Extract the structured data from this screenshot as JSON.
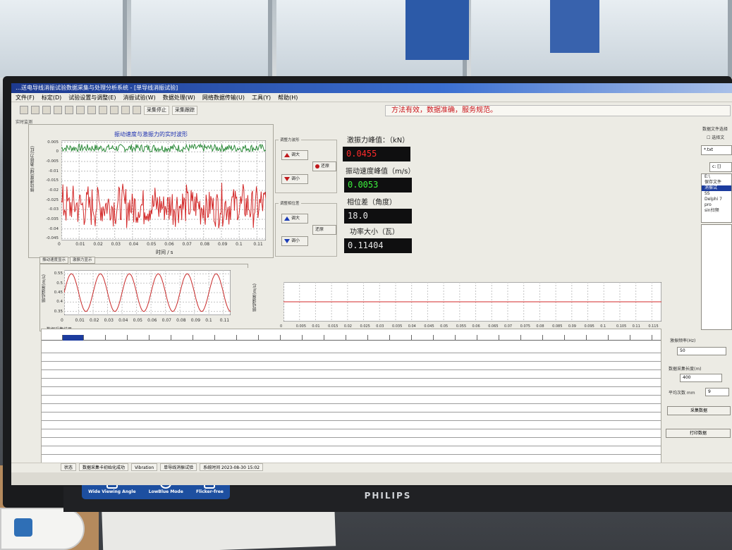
{
  "window": {
    "title": "…送电导线消振试验数据采集与处理分析系统 - [单导线消振试验]"
  },
  "menu": [
    "文件(F)",
    "标定(D)",
    "试验设置与调整(E)",
    "消振试验(W)",
    "数据处理(W)",
    "网络数据传输(U)",
    "工具(Y)",
    "帮助(H)"
  ],
  "toolbar": {
    "collect_label": "采集停止",
    "collect_trace_label": "采集跟踪",
    "slogan": "方法有效，数据准确，服务规范。"
  },
  "section_label": "实时监测",
  "top_chart": {
    "title": "振动速度与激振力的实时波形",
    "ylabel": "振动速度(绿)  激振力(红)",
    "xlabel": "时间 / s"
  },
  "controls": {
    "force_group": "调整力波形",
    "force_up": "调大",
    "force_down": "调小",
    "force_reset": "还原",
    "phase_group": "调整相位差",
    "phase_up": "调大",
    "phase_down": "调小",
    "phase_reset": "还原"
  },
  "readouts": {
    "force_label": "激振力峰值：（kN）",
    "force_value": "0.0455",
    "velocity_label": "振动速度峰值（m/s）",
    "velocity_value": "0.0053",
    "phase_label": "相位差（角度）",
    "phase_value": "18.0",
    "power_label": "功率大小（瓦）",
    "power_value": "0.11404"
  },
  "file_panel": {
    "title": "数据文件选择",
    "option": "选择文",
    "filter": "*.txt",
    "drive": "c: []",
    "tree": [
      "E:\\",
      "保存文件",
      "消振试",
      "SS",
      "Delphi 7",
      "pro",
      "sin扫频"
    ]
  },
  "lower_tabs": [
    "振动速度显示",
    "激振力显示"
  ],
  "mid_chart": {
    "ylabel": "振动速度(m/s)",
    "x_ticks": [
      "0",
      "0.01",
      "0.02",
      "0.03",
      "0.04",
      "0.05",
      "0.06",
      "0.07",
      "0.08",
      "0.09",
      "0.1",
      "0.11"
    ],
    "y_ticks": [
      "0.55",
      "0.5",
      "0.45",
      "0.4",
      "0.35"
    ]
  },
  "mid_chart2": {
    "ylabel": "振动速度(m/s)",
    "x_ticks": [
      "0",
      "0.005",
      "0.01",
      "0.015",
      "0.02",
      "0.025",
      "0.03",
      "0.035",
      "0.04",
      "0.045",
      "0.05",
      "0.055",
      "0.06",
      "0.065",
      "0.07",
      "0.075",
      "0.08",
      "0.085",
      "0.09",
      "0.095",
      "0.1",
      "0.105",
      "0.11",
      "0.115"
    ]
  },
  "table": {
    "title": "数据采集结果"
  },
  "right_lower": {
    "freq_label": "激振频率(Hz)",
    "freq_value": "50",
    "len_label": "数据采集长度(m)",
    "len_value": "400",
    "count_label": "平均次数  mm",
    "count_value": "9",
    "save_btn": "采集数据",
    "print_btn": "打印数据"
  },
  "statusbar": {
    "items": [
      "状态",
      "数据采集卡初始化成功",
      "Vibration",
      "单导线消振试验",
      "系统时间 2023-08-30 15:02"
    ]
  },
  "monitor": {
    "brand": "PHILIPS",
    "sticker": [
      "Wide Viewing Angle",
      "LowBlue Mode",
      "Flicker-free"
    ]
  },
  "chart_data": [
    {
      "type": "line",
      "title": "振动速度与激振力的实时波形",
      "xlabel": "时间 / s",
      "ylabel": "振动速度(绿)  激振力(红)",
      "x_ticks": [
        "0",
        "0.01",
        "0.02",
        "0.03",
        "0.04",
        "0.05",
        "0.06",
        "0.07",
        "0.08",
        "0.09",
        "0.1",
        "0.11"
      ],
      "y_ticks": [
        "0.005",
        "0",
        "-0.005",
        "-0.01",
        "-0.015",
        "-0.02",
        "-0.025",
        "-0.03",
        "-0.035",
        "-0.04",
        "-0.045"
      ],
      "xlim": [
        0,
        0.115
      ],
      "ylim": [
        -0.046,
        0.006
      ],
      "grid": true,
      "series": [
        {
          "color": "#2e8b3b",
          "y_center": 0.002,
          "amplitude": 0.002
        },
        {
          "color": "#d32a2a",
          "y_center": -0.028,
          "amplitude": 0.012
        }
      ]
    },
    {
      "type": "line",
      "ylabel": "振动速度(m/s)",
      "x_ticks": [
        "0",
        "0.01",
        "0.02",
        "0.03",
        "0.04",
        "0.05",
        "0.06",
        "0.07",
        "0.08",
        "0.09",
        "0.1",
        "0.11"
      ],
      "y_ticks": [
        "0.55",
        "0.5",
        "0.45",
        "0.4",
        "0.35"
      ],
      "xlim": [
        0,
        0.115
      ],
      "ylim": [
        0.33,
        0.57
      ],
      "grid": true,
      "series": [
        {
          "color": "#c92a2a",
          "waveform": "sine",
          "period": 0.02,
          "y_center": 0.45,
          "amplitude": 0.1
        }
      ]
    },
    {
      "type": "line",
      "ylabel": "振动速度(m/s)",
      "xlim": [
        0,
        0.118
      ],
      "grid": true,
      "series": [
        {
          "color": "#d32a2a",
          "waveform": "flat",
          "value": 0
        }
      ]
    }
  ]
}
